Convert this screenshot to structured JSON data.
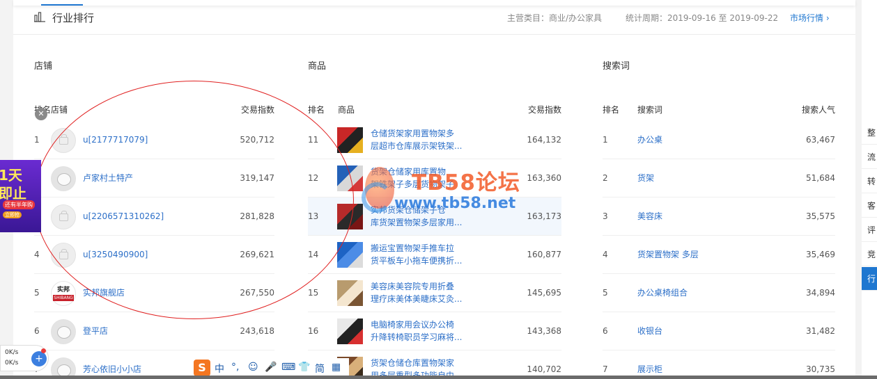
{
  "header": {
    "title": "行业排行",
    "category_label": "主营类目：商业/办公家具",
    "period_label": "统计周期：2019-09-16 至 2019-09-22",
    "market_link": "市场行情 ›"
  },
  "sections": {
    "shops": {
      "title": "店铺",
      "col_rank_shop": "排名店铺",
      "col_index": "交易指数",
      "rows": [
        {
          "rank": "1",
          "name": "u[2177717079]",
          "value": "520,712",
          "avatar": "placeholder"
        },
        {
          "rank": "2",
          "name": "卢家村土特产",
          "value": "319,147",
          "avatar": "cat"
        },
        {
          "rank": "3",
          "name": "u[2206571310262]",
          "value": "281,828",
          "avatar": "placeholder"
        },
        {
          "rank": "4",
          "name": "u[3250490900]",
          "value": "269,621",
          "avatar": "placeholder"
        },
        {
          "rank": "5",
          "name": "实邦旗舰店",
          "value": "267,550",
          "avatar": "logo",
          "logo_top": "实邦",
          "logo_bottom": "SHIBANG"
        },
        {
          "rank": "6",
          "name": "登平店",
          "value": "243,618",
          "avatar": "cat"
        },
        {
          "rank": "7",
          "name": "芳心依旧小小店",
          "value": "",
          "avatar": "cat"
        }
      ]
    },
    "products": {
      "title": "商品",
      "col_rank": "排名",
      "col_product": "商品",
      "col_index": "交易指数",
      "rows": [
        {
          "rank": "11",
          "line1": "仓储货架家用置物架多",
          "line2": "层超市仓库展示架铁架...",
          "value": "164,132"
        },
        {
          "rank": "12",
          "line1": "货架仓储家用库置物",
          "line2": "架铁架子多层货物架子",
          "value": "163,360"
        },
        {
          "rank": "13",
          "line1": "实邦货架仓储架子仓",
          "line2": "库货架置物架多层家用...",
          "value": "163,173"
        },
        {
          "rank": "14",
          "line1": "搬运宝置物架手推车拉",
          "line2": "货平板车小拖车便携折...",
          "value": "160,877"
        },
        {
          "rank": "15",
          "line1": "美容床美容院专用折叠",
          "line2": "理疗床美体美睫床艾灸...",
          "value": "145,695"
        },
        {
          "rank": "16",
          "line1": "电脑椅家用会议办公椅",
          "line2": "升降转椅职员学习麻将...",
          "value": "143,368"
        },
        {
          "rank": "17",
          "line1": "货架仓储仓库置物架家",
          "line2": "用多层重型多功能自由",
          "value": "140,702"
        }
      ]
    },
    "keywords": {
      "title": "搜索词",
      "col_rank": "排名",
      "col_keyword": "搜索词",
      "col_pop": "搜索人气",
      "rows": [
        {
          "rank": "1",
          "keyword": "办公桌",
          "value": "63,467"
        },
        {
          "rank": "2",
          "keyword": "货架",
          "value": "51,684"
        },
        {
          "rank": "3",
          "keyword": "美容床",
          "value": "35,575"
        },
        {
          "rank": "4",
          "keyword": "货架置物架 多层",
          "value": "35,469"
        },
        {
          "rank": "5",
          "keyword": "办公桌椅组合",
          "value": "34,894"
        },
        {
          "rank": "6",
          "keyword": "收银台",
          "value": "31,482"
        },
        {
          "rank": "7",
          "keyword": "展示柜",
          "value": "30,735"
        }
      ]
    }
  },
  "right_panel": {
    "items": [
      "整",
      "流",
      "转",
      "客",
      "评",
      "竞",
      "行"
    ]
  },
  "ad": {
    "line1": "1天",
    "line2": "即止",
    "line3": "还有半年购",
    "line4": "立即抢"
  },
  "net_widget": {
    "upload": "0K/s",
    "download": "0K/s",
    "plus": "+"
  },
  "ime_toolbar": {
    "logo": "S",
    "items": [
      "中",
      "°,",
      "☺",
      "🎤",
      "⌨",
      "👕",
      "简",
      "▦"
    ]
  },
  "watermark": {
    "text1": "TB58论坛",
    "text2": "www.tb58.net"
  }
}
